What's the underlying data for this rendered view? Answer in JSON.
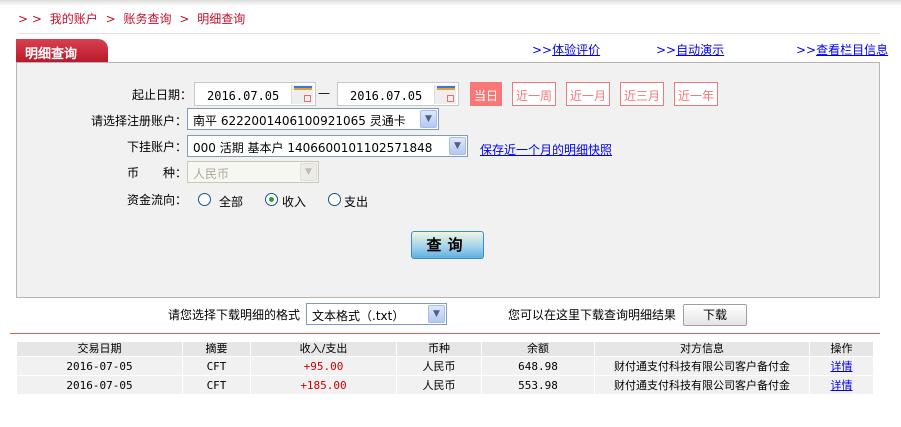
{
  "breadcrumb": [
    "> >",
    "我的账户",
    ">",
    "账务查询",
    ">",
    "明细查询"
  ],
  "tab_title": "明细查询",
  "top_links": [
    {
      "prefix": ">>",
      "label": "体验评价"
    },
    {
      "prefix": ">>",
      "label": "自动演示"
    },
    {
      "prefix": ">>",
      "label": "查看栏目信息"
    }
  ],
  "form": {
    "date_label": "起止日期：",
    "start_date": "2016.07.05",
    "dash": "—",
    "end_date": "2016.07.05",
    "quick_ranges": [
      {
        "label": "当日",
        "active": true
      },
      {
        "label": "近一周"
      },
      {
        "label": "近一月"
      },
      {
        "label": "近三月"
      },
      {
        "label": "近一年"
      }
    ],
    "account_label": "请选择注册账户：",
    "account_value": "南平 6222001406100921065 灵通卡",
    "sub_account_label": "下挂账户：",
    "sub_account_value": "000 活期 基本户 1406600101102571848",
    "snapshot_link": "保存近一个月的明细快照",
    "currency_label": "币　　种：",
    "currency_value": "人民币",
    "flow_label": "资金流向：",
    "flow_options": [
      {
        "label": "全部",
        "checked": false
      },
      {
        "label": "收入",
        "checked": true
      },
      {
        "label": "支出",
        "checked": false
      }
    ],
    "query_button": "查询"
  },
  "download": {
    "format_label": "请您选择下载明细的格式",
    "format_value": "文本格式（.txt）",
    "hint": "您可以在这里下载查询明细结果",
    "button": "下载"
  },
  "table": {
    "headers": [
      "交易日期",
      "摘要",
      "收入/支出",
      "币种",
      "余额",
      "对方信息",
      "操作"
    ],
    "rows": [
      [
        "2016-07-05",
        "CFT",
        "+95.00",
        "人民币",
        "648.98",
        "财付通支付科技有限公司客户备付金",
        "详情"
      ],
      [
        "2016-07-05",
        "CFT",
        "+185.00",
        "人民币",
        "553.98",
        "财付通支付科技有限公司客户备付金",
        "详情"
      ]
    ]
  },
  "colors": {
    "brand_red": "#c0102a",
    "quick_range": "#f87878",
    "link": "#0000ee",
    "amount": "#d00000"
  }
}
